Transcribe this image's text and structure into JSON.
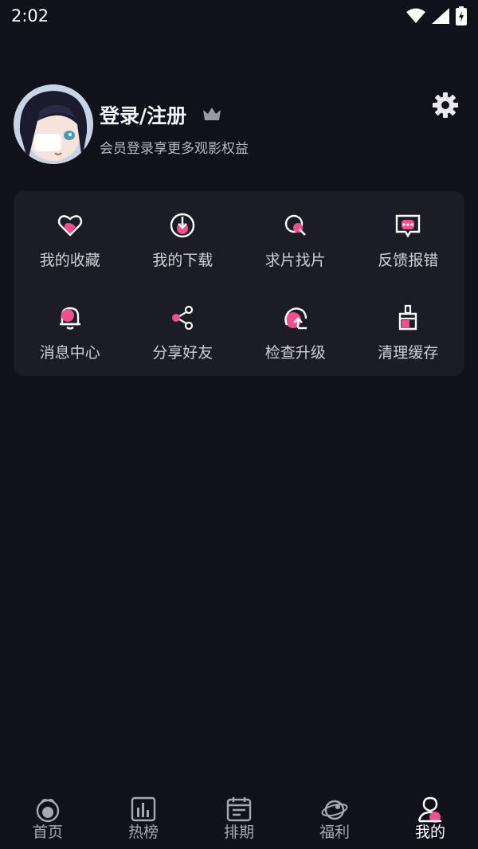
{
  "status": {
    "time": "2:02"
  },
  "profile": {
    "title": "登录/注册",
    "subtitle": "会员登录享更多观影权益"
  },
  "menu": {
    "items": [
      {
        "label": "我的收藏",
        "icon": "heart-icon"
      },
      {
        "label": "我的下载",
        "icon": "download-icon"
      },
      {
        "label": "求片找片",
        "icon": "search-film-icon"
      },
      {
        "label": "反馈报错",
        "icon": "feedback-icon"
      },
      {
        "label": "消息中心",
        "icon": "bell-icon"
      },
      {
        "label": "分享好友",
        "icon": "share-icon"
      },
      {
        "label": "检查升级",
        "icon": "upgrade-icon"
      },
      {
        "label": "清理缓存",
        "icon": "broom-icon"
      }
    ]
  },
  "tabs": [
    {
      "label": "首页",
      "icon": "home-icon"
    },
    {
      "label": "热榜",
      "icon": "chart-icon"
    },
    {
      "label": "排期",
      "icon": "calendar-icon"
    },
    {
      "label": "福利",
      "icon": "planet-icon"
    },
    {
      "label": "我的",
      "icon": "profile-icon",
      "active": true
    }
  ],
  "colors": {
    "background": "#11111b",
    "card": "#1c1c27",
    "accent": "#f0508a"
  }
}
